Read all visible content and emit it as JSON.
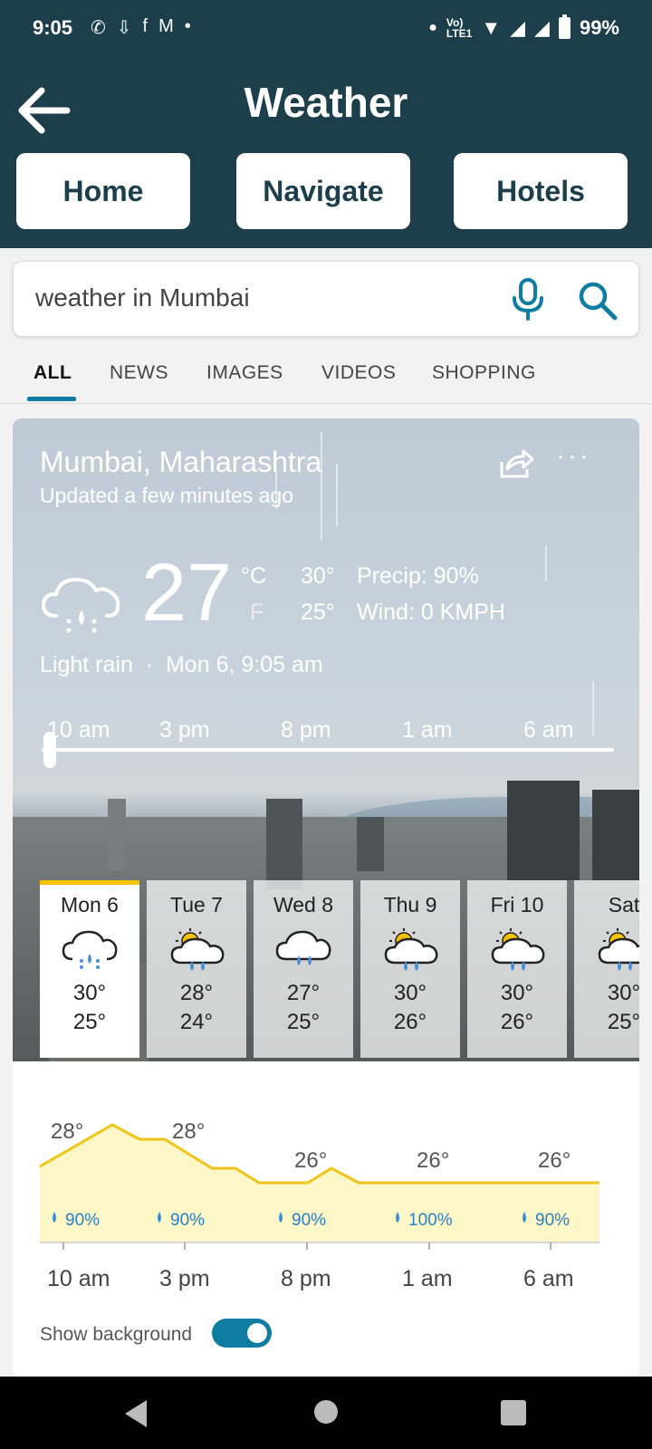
{
  "status": {
    "time": "9:05",
    "battery": "99%",
    "icons": [
      "whatsapp-icon",
      "download-icon",
      "facebook-icon",
      "gmail-icon",
      "dot-icon",
      "volte-icon",
      "wifi-icon",
      "signal-icon",
      "signal-icon",
      "battery-icon"
    ]
  },
  "appbar": {
    "title": "Weather",
    "buttons": [
      "Home",
      "Navigate",
      "Hotels"
    ]
  },
  "search": {
    "value": "weather in Mumbai"
  },
  "tabs": [
    "ALL",
    "NEWS",
    "IMAGES",
    "VIDEOS",
    "SHOPPING"
  ],
  "weather": {
    "location": "Mumbai, Maharashtra",
    "updated": "Updated a few minutes ago",
    "temp": "27",
    "unit_c": "°C",
    "unit_f": "F",
    "high": "30°",
    "low": "25°",
    "precip": "Precip: 90%",
    "wind": "Wind: 0 KMPH",
    "condition": "Light rain",
    "datetime": "Mon 6, 9:05 am",
    "slider_hours": [
      "10 am",
      "3 pm",
      "8 pm",
      "1 am",
      "6 am"
    ],
    "days": [
      {
        "name": "Mon 6",
        "hi": "30°",
        "lo": "25°",
        "icon": "rain-cloud-icon"
      },
      {
        "name": "Tue 7",
        "hi": "28°",
        "lo": "24°",
        "icon": "sun-rain-cloud-icon"
      },
      {
        "name": "Wed 8",
        "hi": "27°",
        "lo": "25°",
        "icon": "rain-cloud-icon"
      },
      {
        "name": "Thu 9",
        "hi": "30°",
        "lo": "26°",
        "icon": "sun-rain-cloud-icon"
      },
      {
        "name": "Fri 10",
        "hi": "30°",
        "lo": "26°",
        "icon": "sun-rain-cloud-icon"
      },
      {
        "name": "Sat",
        "hi": "30°",
        "lo": "25°",
        "icon": "sun-rain-cloud-icon"
      }
    ],
    "hourly_chart": {
      "temp_labels": [
        "28°",
        "28°",
        "26°",
        "26°",
        "26°"
      ],
      "precip_labels": [
        "90%",
        "90%",
        "90%",
        "100%",
        "90%"
      ],
      "hour_labels": [
        "10 am",
        "3 pm",
        "8 pm",
        "1 am",
        "6 am"
      ]
    },
    "show_background_label": "Show background"
  },
  "colors": {
    "header": "#1c3f4b",
    "accent": "#0f7da2",
    "selected_day": "#f4c300",
    "chart_fill": "#fdf6c6",
    "chart_line": "#f0c419"
  }
}
